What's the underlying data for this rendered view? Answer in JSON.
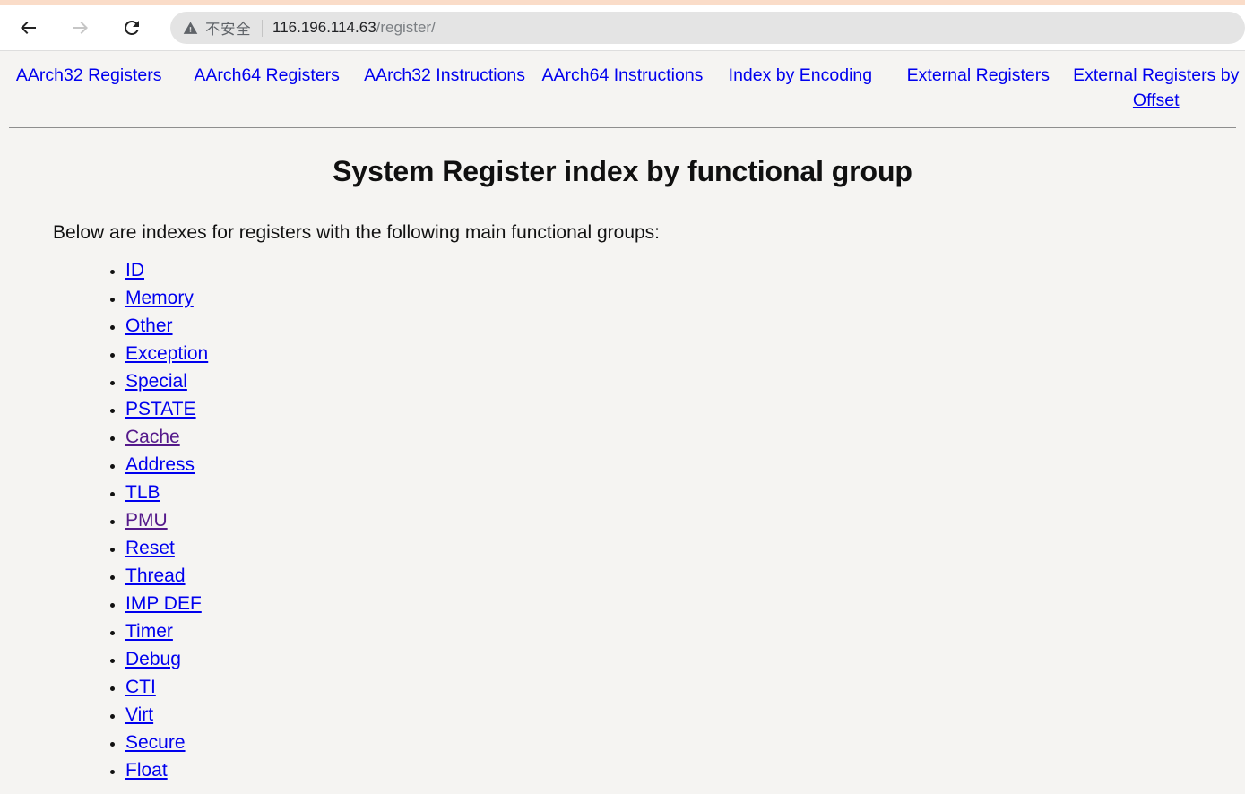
{
  "browser": {
    "back_icon": "back-arrow-icon",
    "forward_icon": "forward-arrow-icon",
    "reload_icon": "reload-icon",
    "security_warning_icon": "warning-triangle-icon",
    "security_label": "不安全",
    "url_host": "116.196.114.63",
    "url_path": "/register/",
    "accent_tabstrip_color": "#fadcc8",
    "omnibox_bg_color": "#e4e4e4"
  },
  "site_nav": {
    "items": [
      {
        "label": "AArch32 Registers",
        "visited": false
      },
      {
        "label": "AArch64 Registers",
        "visited": false
      },
      {
        "label": "AArch32 Instructions",
        "visited": false
      },
      {
        "label": "AArch64 Instructions",
        "visited": false
      },
      {
        "label": "Index by Encoding",
        "visited": false
      },
      {
        "label": "External Registers",
        "visited": false
      },
      {
        "label": "External Registers by Offset",
        "visited": false
      }
    ]
  },
  "main": {
    "title": "System Register index by functional group",
    "intro": "Below are indexes for registers with the following main functional groups:",
    "groups": [
      {
        "label": "ID",
        "visited": false
      },
      {
        "label": "Memory",
        "visited": false
      },
      {
        "label": "Other",
        "visited": false
      },
      {
        "label": "Exception",
        "visited": false
      },
      {
        "label": "Special",
        "visited": false
      },
      {
        "label": "PSTATE",
        "visited": false
      },
      {
        "label": "Cache",
        "visited": true
      },
      {
        "label": "Address",
        "visited": false
      },
      {
        "label": "TLB",
        "visited": false
      },
      {
        "label": "PMU",
        "visited": true
      },
      {
        "label": "Reset",
        "visited": false
      },
      {
        "label": "Thread",
        "visited": false
      },
      {
        "label": "IMP DEF",
        "visited": false
      },
      {
        "label": "Timer",
        "visited": false
      },
      {
        "label": "Debug",
        "visited": false
      },
      {
        "label": "CTI",
        "visited": false
      },
      {
        "label": "Virt",
        "visited": false
      },
      {
        "label": "Secure",
        "visited": false
      },
      {
        "label": "Float",
        "visited": false
      }
    ]
  },
  "colors": {
    "link": "#0000ee",
    "visited_link": "#551a8b",
    "page_bg": "#f5f4f2",
    "text": "#111111"
  }
}
